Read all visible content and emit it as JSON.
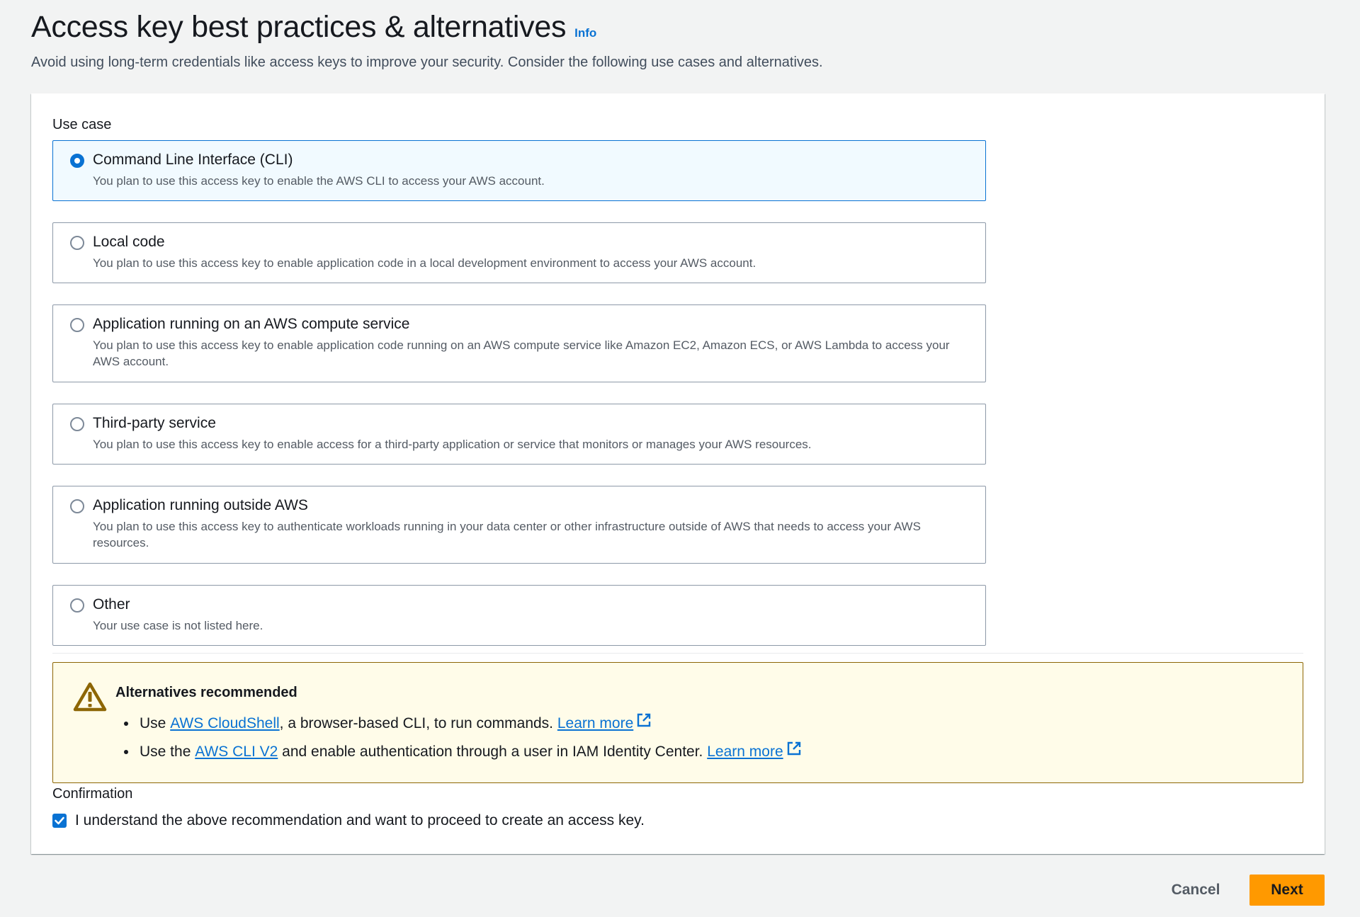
{
  "page": {
    "title": "Access key best practices & alternatives",
    "info_link": "Info",
    "description": "Avoid using long-term credentials like access keys to improve your security. Consider the following use cases and alternatives."
  },
  "use_case": {
    "label": "Use case",
    "selected_index": 0,
    "options": [
      {
        "title": "Command Line Interface (CLI)",
        "description": "You plan to use this access key to enable the AWS CLI to access your AWS account."
      },
      {
        "title": "Local code",
        "description": "You plan to use this access key to enable application code in a local development environment to access your AWS account."
      },
      {
        "title": "Application running on an AWS compute service",
        "description": "You plan to use this access key to enable application code running on an AWS compute service like Amazon EC2, Amazon ECS, or AWS Lambda to access your AWS account."
      },
      {
        "title": "Third-party service",
        "description": "You plan to use this access key to enable access for a third-party application or service that monitors or manages your AWS resources."
      },
      {
        "title": "Application running outside AWS",
        "description": "You plan to use this access key to authenticate workloads running in your data center or other infrastructure outside of AWS that needs to access your AWS resources."
      },
      {
        "title": "Other",
        "description": "Your use case is not listed here."
      }
    ]
  },
  "alert": {
    "title": "Alternatives recommended",
    "items": [
      {
        "prefix": "Use ",
        "link": "AWS CloudShell",
        "suffix": ", a browser-based CLI, to run commands. ",
        "learn_more": "Learn more"
      },
      {
        "prefix": "Use the ",
        "link": "AWS CLI V2",
        "suffix": " and enable authentication through a user in IAM Identity Center. ",
        "learn_more": "Learn more"
      }
    ]
  },
  "confirmation": {
    "label": "Confirmation",
    "checked": true,
    "text": "I understand the above recommendation and want to proceed to create an access key."
  },
  "actions": {
    "cancel_label": "Cancel",
    "next_label": "Next"
  },
  "colors": {
    "accent": "#0972d3",
    "primary_button": "#ff9900",
    "warning_bg": "#fffce9",
    "warning_border": "#8d6605"
  },
  "icons": {
    "alert": "warning-icon",
    "external": "external-link-icon",
    "check": "checkmark-icon"
  }
}
